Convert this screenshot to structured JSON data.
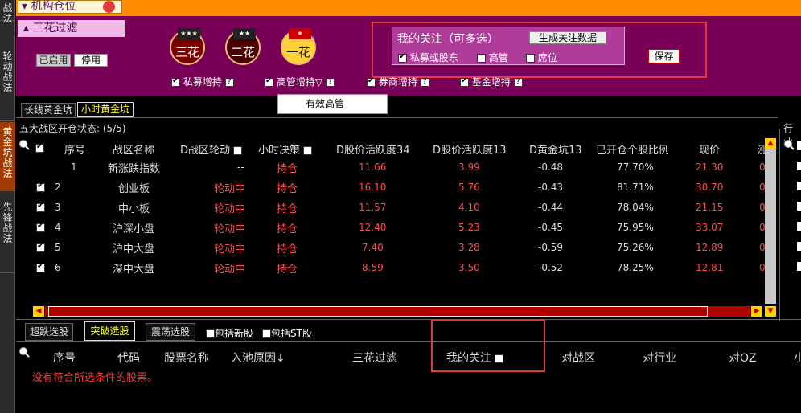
{
  "leftnav": {
    "items": [
      "战法",
      "轮动战法",
      "黄金坑战法",
      "先锋战法"
    ]
  },
  "topbar": {
    "title": "机构仓位"
  },
  "filter": {
    "header": "三花过滤",
    "enabled_label": "已启用",
    "disable_label": "停用",
    "medals": [
      {
        "label": "三花",
        "stars": "★★★"
      },
      {
        "label": "二花",
        "stars": "★★"
      },
      {
        "label": "一花",
        "stars": ""
      }
    ],
    "follow": {
      "title": "我的关注（可多选）",
      "generate_button": "生成关注数据",
      "options": [
        {
          "label": "私募或股东",
          "checked": true
        },
        {
          "label": "高管",
          "checked": false
        },
        {
          "label": "席位",
          "checked": false
        }
      ]
    },
    "save_button": "保存",
    "increase_options": [
      {
        "label": "私募增持",
        "checked": true
      },
      {
        "label": "高管增持▽",
        "checked": true
      },
      {
        "label": "券商增持",
        "checked": true
      },
      {
        "label": "基金增持",
        "checked": true
      }
    ],
    "tooltip": "有效高管"
  },
  "top_tabs": [
    "长线黄金坑",
    "小时黄金坑"
  ],
  "status": {
    "text": "五大战区开仓状态:",
    "value": "(5/5)",
    "right_label": "行业"
  },
  "table": {
    "headers": [
      "序号",
      "战区名称",
      "D战区轮动",
      "小时决策",
      "D股价活跃度34",
      "D股价活跃度13",
      "D黄金坑13",
      "已开仓个股比例",
      "现价",
      "涨"
    ],
    "rows": [
      {
        "checked": false,
        "no": "1",
        "name": "新涨跌指数",
        "rotation": "--",
        "decision": "持仓",
        "act34": "11.66",
        "act13": "3.99",
        "pit13": "-0.48",
        "ratio": "77.70%",
        "price": "21.30",
        "chg": "0"
      },
      {
        "checked": true,
        "no": "2",
        "name": "创业板",
        "rotation": "轮动中",
        "decision": "持仓",
        "act34": "16.10",
        "act13": "5.76",
        "pit13": "-0.43",
        "ratio": "81.71%",
        "price": "30.70",
        "chg": "0"
      },
      {
        "checked": true,
        "no": "3",
        "name": "中小板",
        "rotation": "轮动中",
        "decision": "持仓",
        "act34": "11.57",
        "act13": "4.10",
        "pit13": "-0.44",
        "ratio": "78.04%",
        "price": "21.15",
        "chg": "0"
      },
      {
        "checked": true,
        "no": "4",
        "name": "沪深小盘",
        "rotation": "轮动中",
        "decision": "持仓",
        "act34": "12.40",
        "act13": "5.23",
        "pit13": "-0.45",
        "ratio": "75.95%",
        "price": "33.07",
        "chg": "0"
      },
      {
        "checked": true,
        "no": "5",
        "name": "沪中大盘",
        "rotation": "轮动中",
        "decision": "持仓",
        "act34": "7.40",
        "act13": "3.28",
        "pit13": "-0.59",
        "ratio": "75.26%",
        "price": "12.89",
        "chg": "0"
      },
      {
        "checked": true,
        "no": "6",
        "name": "深中大盘",
        "rotation": "轮动中",
        "decision": "持仓",
        "act34": "8.59",
        "act13": "3.50",
        "pit13": "-0.52",
        "ratio": "78.25%",
        "price": "12.81",
        "chg": "0"
      }
    ]
  },
  "bottom_tabs": [
    "超跌选股",
    "突破选股",
    "震荡选股"
  ],
  "bottom_options": [
    {
      "label": "包括新股",
      "checked": false
    },
    {
      "label": "包括ST股",
      "checked": false
    }
  ],
  "stock_table": {
    "headers": [
      "序号",
      "代码",
      "股票名称",
      "入池原因↓",
      "三花过滤",
      "我的关注",
      "对战区",
      "对行业",
      "对OZ",
      "小"
    ],
    "empty_message": "没有符合所选条件的股票。"
  },
  "colors": {
    "accent_orange": "#ff8c00",
    "panel_purple": "#780056",
    "red_value": "#ff4d4d",
    "highlight_box": "#e03a3a"
  }
}
